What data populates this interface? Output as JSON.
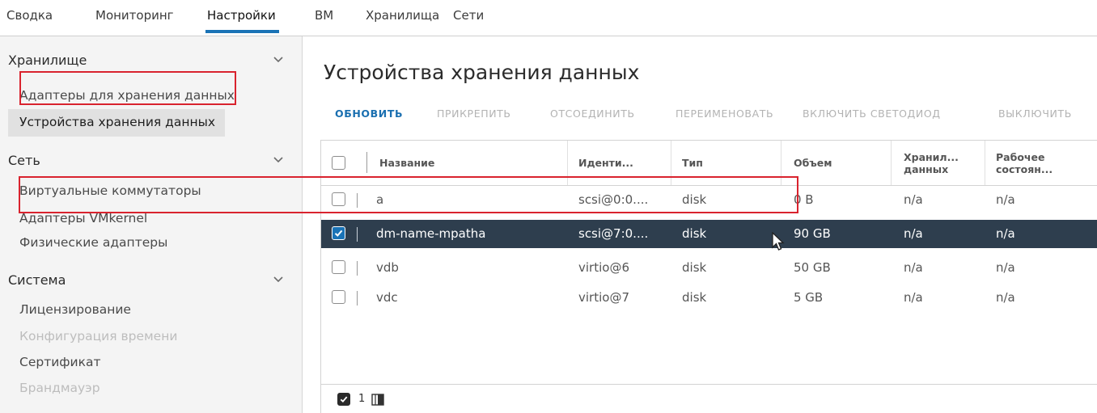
{
  "tabs": [
    "Сводка",
    "Мониторинг",
    "Настройки",
    "ВМ",
    "Хранилища",
    "Сети"
  ],
  "active_tab": "Настройки",
  "sidebar": {
    "sections": [
      {
        "title": "Хранилище",
        "items": [
          {
            "label": "Адаптеры для хранения данных",
            "state": "normal"
          },
          {
            "label": "Устройства хранения данных",
            "state": "selected"
          }
        ]
      },
      {
        "title": "Сеть",
        "items": [
          {
            "label": "Виртуальные коммутаторы",
            "state": "normal"
          },
          {
            "label": "Адаптеры VMkernel",
            "state": "normal"
          },
          {
            "label": "Физические адаптеры",
            "state": "normal"
          }
        ]
      },
      {
        "title": "Система",
        "items": [
          {
            "label": "Лицензирование",
            "state": "normal"
          },
          {
            "label": "Конфигурация времени",
            "state": "disabled"
          },
          {
            "label": "Сертификат",
            "state": "normal"
          },
          {
            "label": "Брандмауэр",
            "state": "disabled"
          }
        ]
      }
    ]
  },
  "main": {
    "title": "Устройства хранения данных",
    "actions": [
      {
        "label": "ОБНОВИТЬ",
        "enabled": true
      },
      {
        "label": "ПРИКРЕПИТЬ",
        "enabled": false
      },
      {
        "label": "ОТСОЕДИНИТЬ",
        "enabled": false
      },
      {
        "label": "ПЕРЕИМЕНОВАТЬ",
        "enabled": false
      },
      {
        "label": "ВКЛЮЧИТЬ СВЕТОДИОД",
        "enabled": false
      },
      {
        "label": "ВЫКЛЮЧИТЬ",
        "enabled": false
      }
    ],
    "table": {
      "columns": [
        "Название",
        "Иденти...",
        "Тип",
        "Объем",
        "Хранил... данных",
        "Рабочее состоян..."
      ],
      "rows": [
        {
          "name": "a",
          "id": "scsi@0:0....",
          "type": "disk",
          "size": "0 B",
          "datastore": "n/a",
          "state": "n/a",
          "checked": false
        },
        {
          "name": "dm-name-mpatha",
          "id": "scsi@7:0....",
          "type": "disk",
          "size": "90 GB",
          "datastore": "n/a",
          "state": "n/a",
          "checked": true
        },
        {
          "name": "vdb",
          "id": "virtio@6",
          "type": "disk",
          "size": "50 GB",
          "datastore": "n/a",
          "state": "n/a",
          "checked": false
        },
        {
          "name": "vdc",
          "id": "virtio@7",
          "type": "disk",
          "size": "5 GB",
          "datastore": "n/a",
          "state": "n/a",
          "checked": false
        }
      ],
      "selected_count": "1"
    }
  },
  "icons": {
    "chevron": "chevron-down-icon",
    "checkbox": "checkbox-icon",
    "columns": "columns-toggle-icon",
    "cursor": "mouse-pointer-icon"
  },
  "colors": {
    "accent": "#1a73b6",
    "highlight_box": "#d9232e",
    "selected_row": "#2e3e4e"
  }
}
